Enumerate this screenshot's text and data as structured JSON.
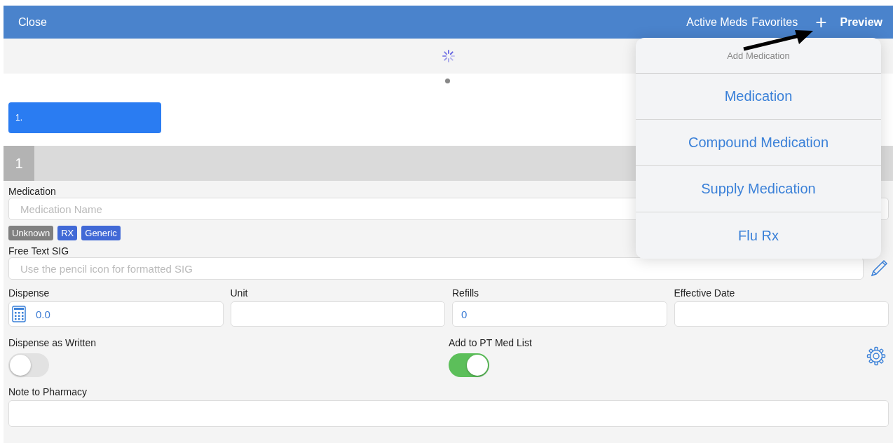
{
  "nav_bar": {
    "close": "Close",
    "actions": [
      "Active Meds",
      "Favorites"
    ],
    "add": "+",
    "preview": "Preview"
  },
  "item_tab": {
    "label": "1."
  },
  "section_header": {
    "number": "1"
  },
  "form": {
    "medication": {
      "label": "Medication",
      "placeholder": "Medication Name"
    },
    "tags": [
      {
        "label": "Unknown",
        "selected": false
      },
      {
        "label": "RX",
        "selected": true
      },
      {
        "label": "Generic",
        "selected": true
      }
    ],
    "sig": {
      "label": "Free Text SIG",
      "placeholder": "Use the pencil icon for formatted SIG"
    },
    "fields": [
      {
        "label": "Dispense",
        "value": "0.0",
        "kind": "calculator"
      },
      {
        "label": "Unit",
        "kind": "text"
      },
      {
        "label": "Refills",
        "value": "0",
        "kind": "text"
      },
      {
        "label": "Effective Date",
        "kind": "text"
      }
    ],
    "toggles": [
      {
        "label": "Dispense as Written",
        "on": false
      },
      {
        "label": "Add to PT Med List",
        "on": true
      }
    ],
    "note": {
      "label": "Note to Pharmacy"
    }
  },
  "popover": {
    "title": "Add Medication",
    "items": [
      "Medication",
      "Compound Medication",
      "Supply Medication",
      "Flu Rx"
    ]
  }
}
